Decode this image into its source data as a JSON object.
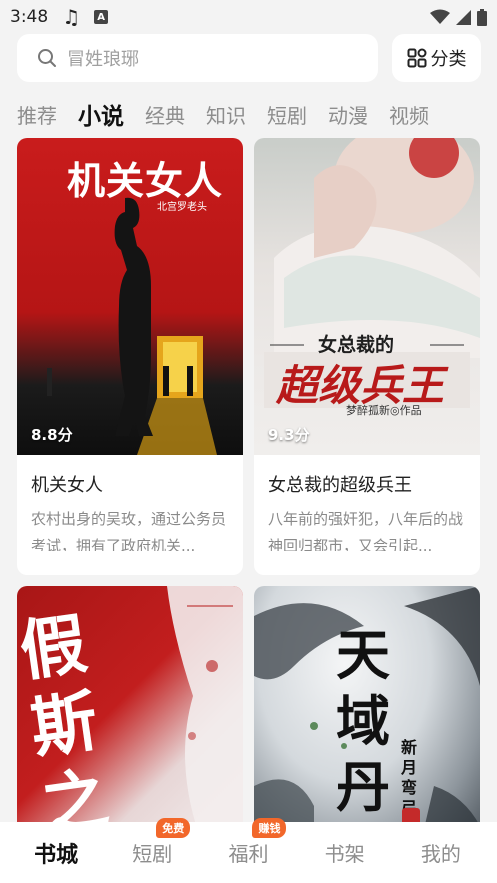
{
  "status_bar": {
    "time": "3:48"
  },
  "search": {
    "placeholder": "冒姓琅琊",
    "category_label": "分类"
  },
  "tabs": [
    "推荐",
    "小说",
    "经典",
    "知识",
    "短剧",
    "动漫",
    "视频"
  ],
  "active_tab": "小说",
  "books": [
    {
      "title": "机关女人",
      "rating": "8.8分",
      "desc": "农村出身的吴玫，通过公务员考试，拥有了政府机关...",
      "cover_title": "机关女人",
      "cover_author": "北宫罗老头"
    },
    {
      "title": "女总裁的超级兵王",
      "rating": "9.3分",
      "desc": "八年前的强奸犯，八年后的战神回归都市，又会引起...",
      "cover_title_small": "女总裁的",
      "cover_title_big": "超级兵王",
      "cover_author": "梦醉孤新◎作品"
    },
    {
      "title": "",
      "rating": "",
      "desc": "",
      "cover_title": "假斯之"
    },
    {
      "title": "",
      "rating": "",
      "desc": "",
      "cover_title": "天域丹尊",
      "cover_author": "新月弯弓"
    }
  ],
  "bottom_nav": [
    {
      "label": "书城",
      "badge": ""
    },
    {
      "label": "短剧",
      "badge": "免费"
    },
    {
      "label": "福利",
      "badge": "赚钱"
    },
    {
      "label": "书架",
      "badge": ""
    },
    {
      "label": "我的",
      "badge": ""
    }
  ],
  "colors": {
    "accent": "#f2672a",
    "background": "#f3f3f3"
  }
}
